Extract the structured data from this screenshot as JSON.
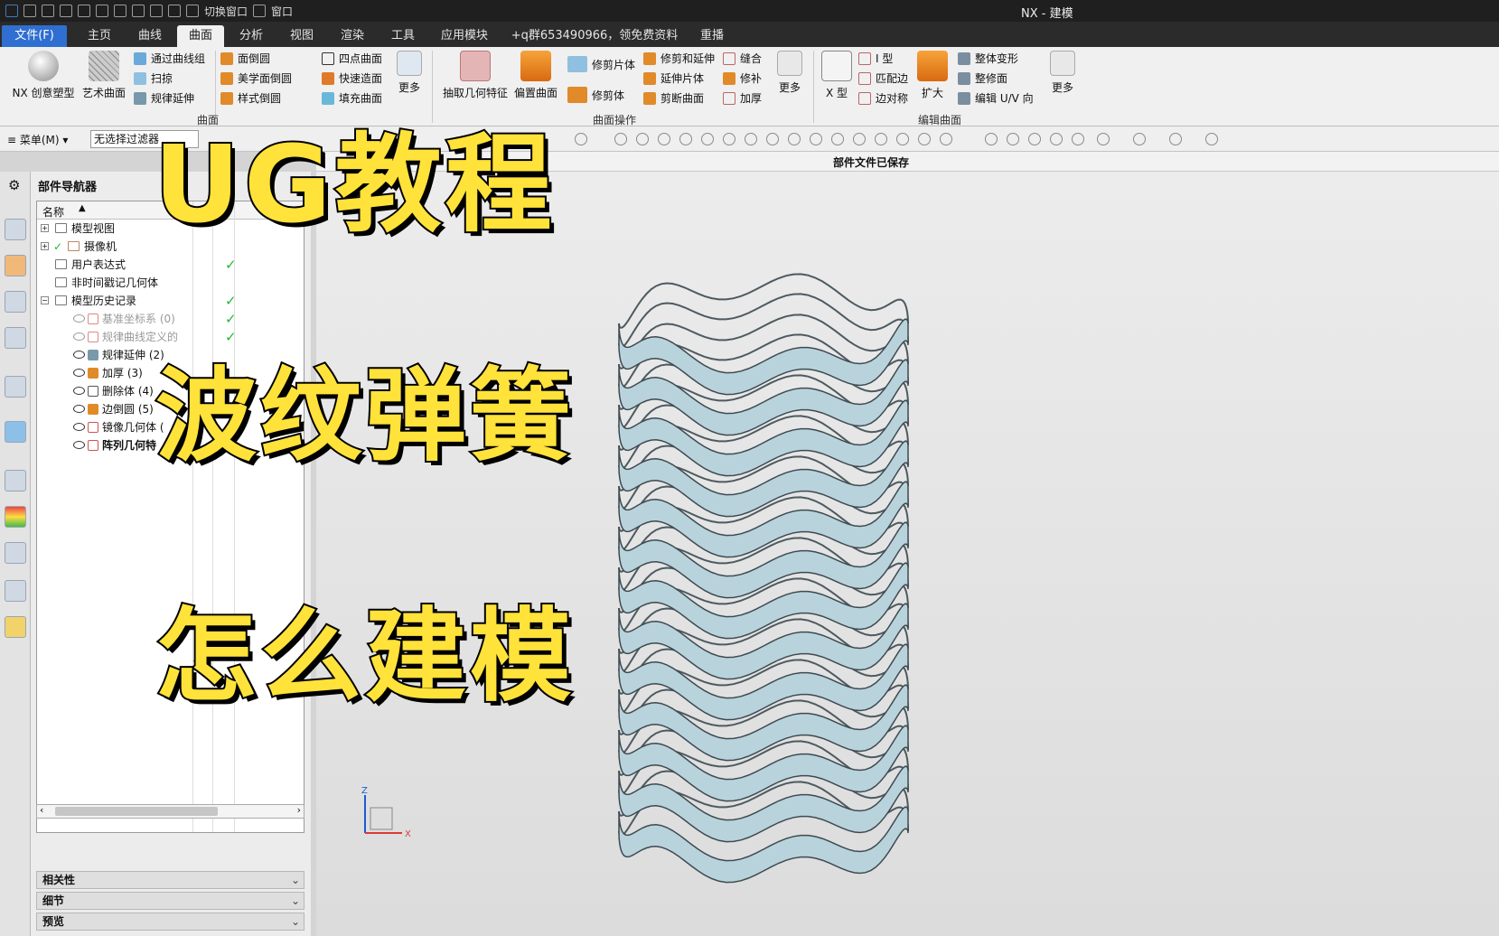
{
  "titlebar": {
    "switch_window": "切换窗口",
    "window_menu": "窗口",
    "app_title": "NX - 建模"
  },
  "tabs": [
    {
      "label": "文件(F)"
    },
    {
      "label": "主页"
    },
    {
      "label": "曲线"
    },
    {
      "label": "曲面"
    },
    {
      "label": "分析"
    },
    {
      "label": "视图"
    },
    {
      "label": "渲染"
    },
    {
      "label": "工具"
    },
    {
      "label": "应用模块"
    },
    {
      "label": "+q群653490966，领免费资料"
    },
    {
      "label": "重播"
    }
  ],
  "ribbon": {
    "nx_creative": "NX 创意塑型",
    "art_surface": "艺术曲面",
    "through_curve_mesh": "通过曲线组",
    "sweep": "扫掠",
    "law_extension": "规律延伸",
    "face_blend": "面倒圆",
    "aesthetic_face_blend": "美学面倒圆",
    "styled_blend": "样式倒圆",
    "group_surface": "曲面",
    "four_point_surface": "四点曲面",
    "rapid_surface": "快速造面",
    "fill_surface": "填充曲面",
    "more1": "更多",
    "extract_geometry": "抽取几何特征",
    "offset_surface": "偏置曲面",
    "trim_sheet": "修剪片体",
    "trim_body": "修剪体",
    "trim_and_extend": "修剪和延伸",
    "extend_sheet": "延伸片体",
    "divide_face": "剪断曲面",
    "sew": "缝合",
    "patch": "修补",
    "thicken": "加厚",
    "more2": "更多",
    "group_surface_ops": "曲面操作",
    "x_form": "X 型",
    "i_form": "I 型",
    "match_edge": "匹配边",
    "edge_symmetry": "边对称",
    "enlarge": "扩大",
    "global_shaping": "整体变形",
    "refit_face": "整修面",
    "edit_uv": "编辑 U/V 向",
    "more3": "更多",
    "group_edit_surface": "编辑曲面"
  },
  "cmdbar": {
    "menu": "菜单(M)",
    "filter": "无选择过滤器"
  },
  "status": "部件文件已保存",
  "navigator": {
    "title": "部件导航器",
    "col_name": "名称",
    "rows": [
      {
        "label": "模型视图",
        "checked": false
      },
      {
        "label": "摄像机",
        "checked": false
      },
      {
        "label": "用户表达式",
        "checked": true
      },
      {
        "label": "非时间戳记几何体",
        "checked": false
      },
      {
        "label": "模型历史记录",
        "checked": true
      },
      {
        "label": "基准坐标系 (0)",
        "checked": true
      },
      {
        "label": "规律曲线定义的",
        "checked": true
      },
      {
        "label": "规律延伸 (2)",
        "checked": false
      },
      {
        "label": "加厚 (3)",
        "checked": false
      },
      {
        "label": "删除体 (4)",
        "checked": false
      },
      {
        "label": "边倒圆 (5)",
        "checked": false
      },
      {
        "label": "镜像几何体 (",
        "checked": false
      },
      {
        "label": "阵列几何特",
        "checked": false
      }
    ],
    "panels": [
      "相关性",
      "细节",
      "预览"
    ]
  },
  "viewport": {
    "axis_z": "Z",
    "axis_x": "X",
    "model_color": "#b9d3dc",
    "background": "#e2e2e2"
  },
  "overlay": {
    "line1": "UG教程",
    "line2": "波纹弹簧",
    "line3": "怎么建模",
    "color": "#ffe23a"
  }
}
